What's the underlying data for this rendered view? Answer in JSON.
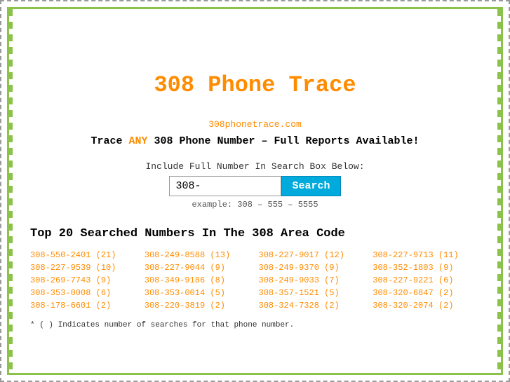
{
  "page": {
    "title": "308 Phone Trace",
    "site_url": "308phonetrace.com",
    "tagline_prefix": "Trace ",
    "tagline_any": "ANY",
    "tagline_suffix": " 308 Phone Number – Full Reports Available!",
    "search_label": "Include Full Number In Search Box Below:",
    "search_value": "308-",
    "search_placeholder": "308-",
    "search_button_label": "Search",
    "search_example": "example: 308 – 555 – 5555",
    "top_numbers_title": "Top 20 Searched Numbers In The 308 Area Code",
    "footnote": "* ( ) Indicates number of searches for that phone number."
  },
  "phone_numbers": [
    {
      "number": "308-550-2401",
      "count": 21
    },
    {
      "number": "308-249-8588",
      "count": 13
    },
    {
      "number": "308-227-9017",
      "count": 12
    },
    {
      "number": "308-227-9713",
      "count": 11
    },
    {
      "number": "308-227-9539",
      "count": 10
    },
    {
      "number": "308-227-9044",
      "count": 9
    },
    {
      "number": "308-249-9370",
      "count": 9
    },
    {
      "number": "308-352-1803",
      "count": 9
    },
    {
      "number": "308-269-7743",
      "count": 9
    },
    {
      "number": "308-349-9186",
      "count": 8
    },
    {
      "number": "308-249-9033",
      "count": 7
    },
    {
      "number": "308-227-9221",
      "count": 6
    },
    {
      "number": "308-353-0008",
      "count": 6
    },
    {
      "number": "308-353-0014",
      "count": 5
    },
    {
      "number": "308-357-1521",
      "count": 5
    },
    {
      "number": "308-320-6847",
      "count": 2
    },
    {
      "number": "308-178-6601",
      "count": 2
    },
    {
      "number": "308-220-3819",
      "count": 2
    },
    {
      "number": "308-324-7328",
      "count": 2
    },
    {
      "number": "308-320-2074",
      "count": 2
    }
  ],
  "colors": {
    "orange": "#ff8c00",
    "blue": "#00aadd",
    "green_border": "#8bc34a"
  }
}
